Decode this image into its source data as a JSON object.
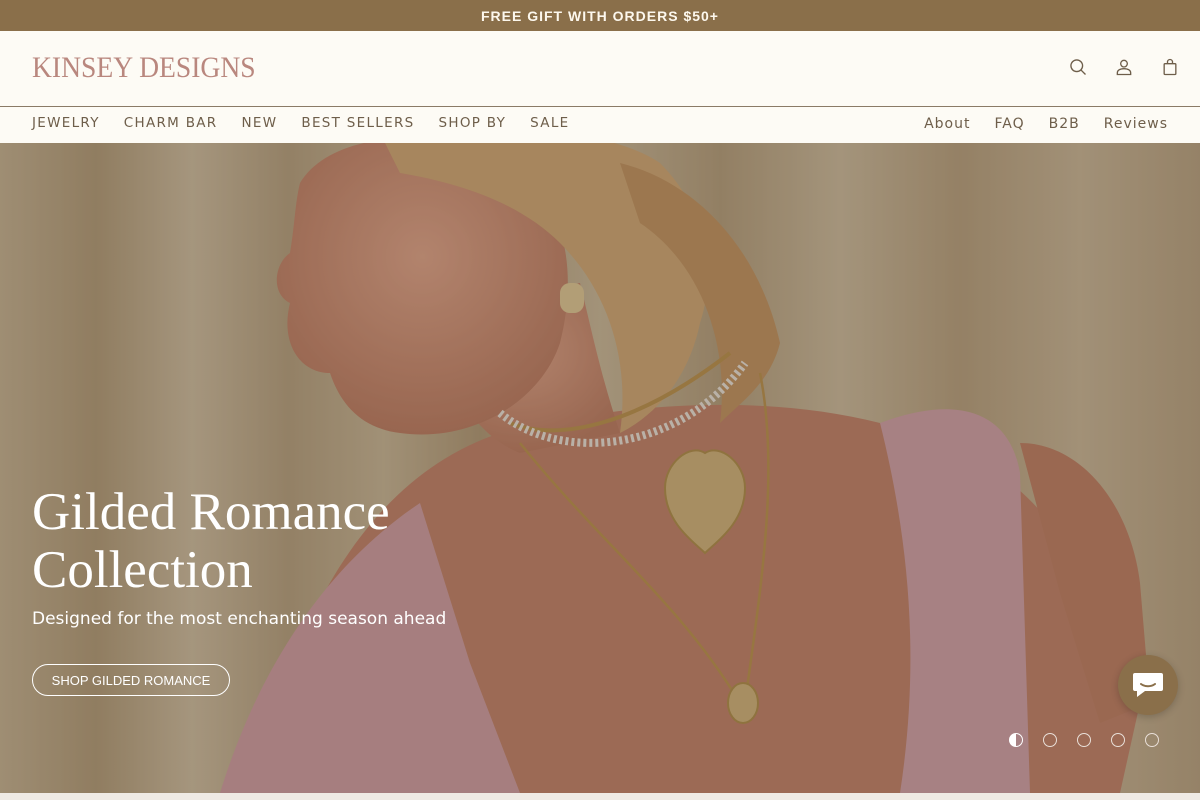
{
  "announcement": {
    "text": "FREE GIFT WITH ORDERS $50+"
  },
  "header": {
    "logo": "Kinsey Designs",
    "icons": [
      "search-icon",
      "account-icon",
      "bag-icon"
    ]
  },
  "nav": {
    "left": [
      "JEWELRY",
      "CHARM BAR",
      "NEW",
      "BEST SELLERS",
      "SHOP BY",
      "SALE"
    ],
    "right": [
      "About",
      "FAQ",
      "B2B",
      "Reviews"
    ]
  },
  "hero": {
    "title_line1": "Gilded Romance",
    "title_line2": "Collection",
    "subtitle": "Designed for the most enchanting season ahead",
    "cta": "SHOP GILDED ROMANCE",
    "slide_count": 5,
    "active_slide": 1
  },
  "chat": {
    "icon": "chat-icon"
  },
  "colors": {
    "announcement_bg": "#8a6f4a",
    "logo": "#b9877e",
    "header_bg": "#fdfbf5"
  }
}
